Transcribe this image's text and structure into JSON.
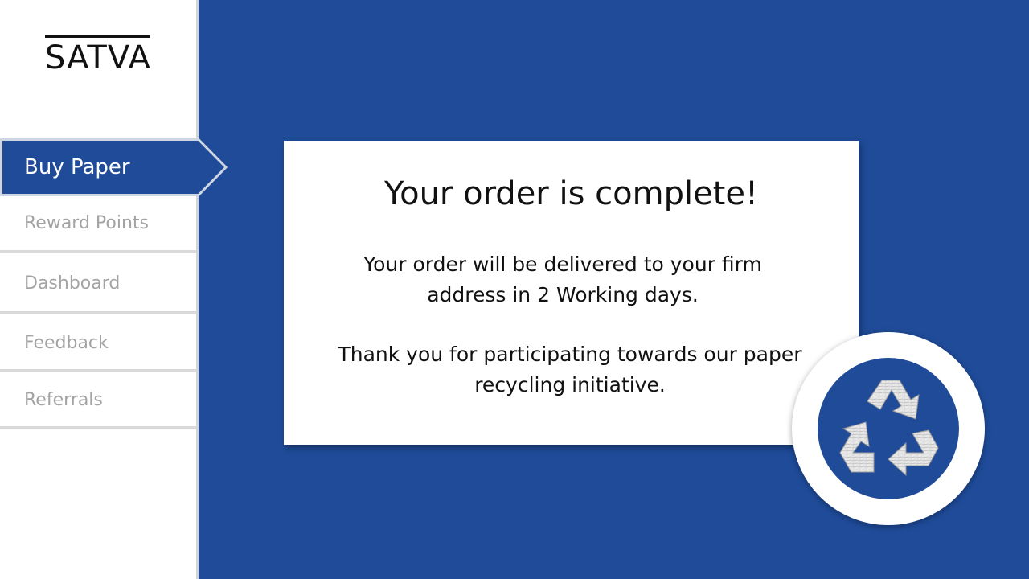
{
  "brand": {
    "logo_text": "SATVA"
  },
  "sidebar": {
    "items": [
      {
        "label": "Buy Paper",
        "active": true
      },
      {
        "label": "Reward Points",
        "active": false
      },
      {
        "label": "Dashboard",
        "active": false
      },
      {
        "label": "Feedback",
        "active": false
      },
      {
        "label": "Referrals",
        "active": false
      }
    ]
  },
  "main": {
    "title": "Your order is complete!",
    "delivery_message": "Your order will be delivered to your firm address in 2 Working days.",
    "thanks_message": "Thank you for participating towards our paper recycling initiative.",
    "badge_icon": "recycle-icon"
  },
  "colors": {
    "primary": "#1f4b99",
    "card_background": "#ffffff",
    "nav_inactive_text": "#a3a3a3",
    "nav_active_text": "#ffffff"
  }
}
